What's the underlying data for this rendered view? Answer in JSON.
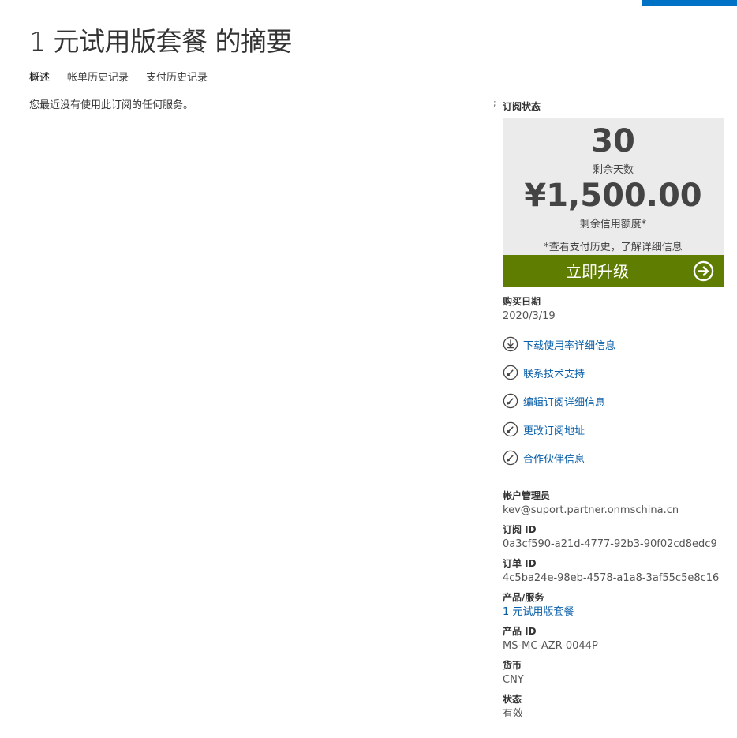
{
  "header": {
    "title": "1 元试用版套餐 的摘要"
  },
  "tabs": [
    {
      "label": "概述",
      "active": true
    },
    {
      "label": "帐单历史记录",
      "active": false
    },
    {
      "label": "支付历史记录",
      "active": false
    }
  ],
  "main": {
    "message": "您最近没有使用此订阅的任何服务。"
  },
  "side_marker": ";",
  "subscription_status": {
    "label": "订阅状态",
    "days_remaining": "30",
    "days_label": "剩余天数",
    "credit_amount": "¥1,500.00",
    "credit_label": "剩余信用额度*",
    "note": "*查看支付历史，了解详细信息",
    "upgrade_label": "立即升级",
    "upgrade_icon": "arrow-right-circle-icon"
  },
  "purchase": {
    "label": "购买日期",
    "value": "2020/3/19"
  },
  "actions": [
    {
      "label": "下载使用率详细信息",
      "icon": "download-icon"
    },
    {
      "label": "联系技术支持",
      "icon": "edit-icon"
    },
    {
      "label": "编辑订阅详细信息",
      "icon": "edit-icon"
    },
    {
      "label": "更改订阅地址",
      "icon": "edit-icon"
    },
    {
      "label": "合作伙伴信息",
      "icon": "edit-icon"
    }
  ],
  "info": [
    {
      "label": "帐户管理员",
      "value": "kev@suport.partner.onmschina.cn",
      "link": false
    },
    {
      "label": "订阅 ID",
      "value": "0a3cf590-a21d-4777-92b3-90f02cd8edc9",
      "link": false
    },
    {
      "label": "订单 ID",
      "value": "4c5ba24e-98eb-4578-a1a8-3af55c5e8c16",
      "link": false
    },
    {
      "label": "产品/服务",
      "value": "1 元试用版套餐",
      "link": true
    },
    {
      "label": "产品 ID",
      "value": "MS-MC-AZR-0044P",
      "link": false
    },
    {
      "label": "货币",
      "value": "CNY",
      "link": false
    },
    {
      "label": "状态",
      "value": "有效",
      "link": false
    }
  ],
  "colors": {
    "accent": "#0072c6",
    "upgrade_button": "#5f7d00",
    "status_box": "#ebebeb",
    "link": "#0a5fa8"
  }
}
